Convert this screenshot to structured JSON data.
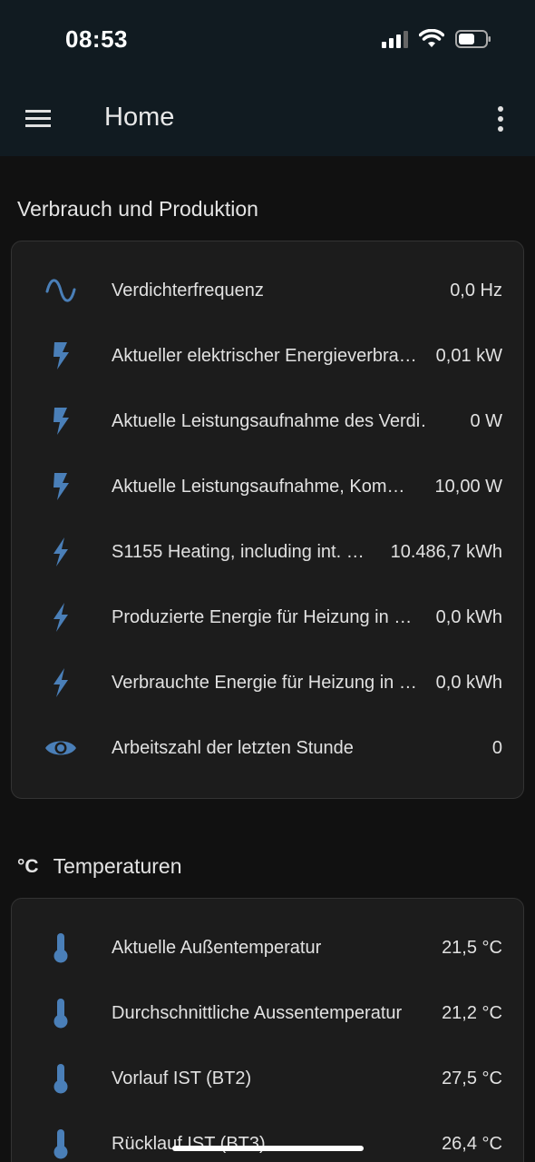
{
  "status_bar": {
    "time": "08:53"
  },
  "header": {
    "title": "Home"
  },
  "colors": {
    "accent_icon": "#4a7fb8",
    "header_bg": "#111b21",
    "page_bg": "#111111",
    "card_bg": "#1c1c1c"
  },
  "section1": {
    "title": "Verbrauch und Produktion",
    "rows": [
      {
        "icon": "sine-wave-icon",
        "label": "Verdichterfrequenz",
        "value": "0,0 Hz"
      },
      {
        "icon": "lightning-bolt-icon",
        "label": "Aktueller elektrischer Energieverbra…",
        "value": "0,01 kW"
      },
      {
        "icon": "lightning-bolt-icon",
        "label": "Aktuelle Leistungsaufnahme des Verdi…",
        "value": "0 W"
      },
      {
        "icon": "lightning-bolt-icon",
        "label": "Aktuelle Leistungsaufnahme, Kom…",
        "value": "10,00 W"
      },
      {
        "icon": "flash-icon",
        "label": "S1155 Heating, including int. …",
        "value": "10.486,7 kWh"
      },
      {
        "icon": "flash-icon",
        "label": "Produzierte Energie für Heizung in …",
        "value": "0,0 kWh"
      },
      {
        "icon": "flash-icon",
        "label": "Verbrauchte Energie für Heizung in …",
        "value": "0,0 kWh"
      },
      {
        "icon": "eye-icon",
        "label": "Arbeitszahl der letzten Stunde",
        "value": "0"
      }
    ]
  },
  "section2": {
    "icon_text": "°C",
    "title": "Temperaturen",
    "rows": [
      {
        "icon": "thermometer-icon",
        "label": "Aktuelle Außentemperatur",
        "value": "21,5 °C"
      },
      {
        "icon": "thermometer-icon",
        "label": "Durchschnittliche Aussentemperatur",
        "value": "21,2 °C"
      },
      {
        "icon": "thermometer-icon",
        "label": "Vorlauf IST (BT2)",
        "value": "27,5 °C"
      },
      {
        "icon": "thermometer-icon",
        "label": "Rücklauf IST (BT3)",
        "value": "26,4 °C"
      }
    ]
  }
}
